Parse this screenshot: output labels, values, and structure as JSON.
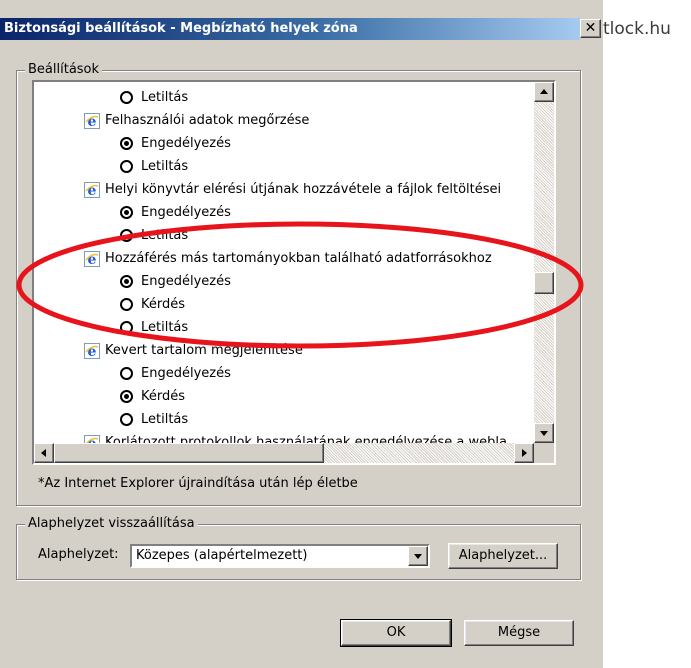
{
  "watermark": "tlock.hu",
  "window": {
    "title": "Biztonsági beállítások - Megbízható helyek zóna",
    "close_glyph": "✕"
  },
  "settings_group": {
    "legend": "Beállítások",
    "items": [
      {
        "kind": "option",
        "label": "Letiltás",
        "checked": false
      },
      {
        "kind": "category",
        "label": "Felhasználói adatok megőrzése",
        "icon": "ie-icon"
      },
      {
        "kind": "option",
        "label": "Engedélyezés",
        "checked": true
      },
      {
        "kind": "option",
        "label": "Letiltás",
        "checked": false
      },
      {
        "kind": "category",
        "label": "Helyi könyvtár elérési útjának hozzávétele a fájlok feltöltései",
        "icon": "ie-icon"
      },
      {
        "kind": "option",
        "label": "Engedélyezés",
        "checked": true
      },
      {
        "kind": "option",
        "label": "Letiltás",
        "checked": false
      },
      {
        "kind": "category",
        "label": "Hozzáférés más tartományokban található adatforrásokhoz",
        "icon": "ie-icon"
      },
      {
        "kind": "option",
        "label": "Engedélyezés",
        "checked": true
      },
      {
        "kind": "option",
        "label": "Kérdés",
        "checked": false
      },
      {
        "kind": "option",
        "label": "Letiltás",
        "checked": false
      },
      {
        "kind": "category",
        "label": "Kevert tartalom megjelenítése",
        "icon": "ie-icon"
      },
      {
        "kind": "option",
        "label": "Engedélyezés",
        "checked": false
      },
      {
        "kind": "option",
        "label": "Kérdés",
        "checked": true
      },
      {
        "kind": "option",
        "label": "Letiltás",
        "checked": false
      },
      {
        "kind": "category",
        "label": "Korlátozott protokollok használatának engedélyezése a webla",
        "icon": "ie-icon"
      }
    ],
    "note": "*Az Internet Explorer újraindítása után lép életbe"
  },
  "reset_group": {
    "legend": "Alaphelyzet visszaállítása",
    "level_label": "Alaphelyzet:",
    "level_value": "Közepes (alapértelmezett)",
    "reset_button": "Alaphelyzet..."
  },
  "buttons": {
    "ok": "OK",
    "cancel": "Mégse"
  },
  "annotation_color": "#e8141b"
}
